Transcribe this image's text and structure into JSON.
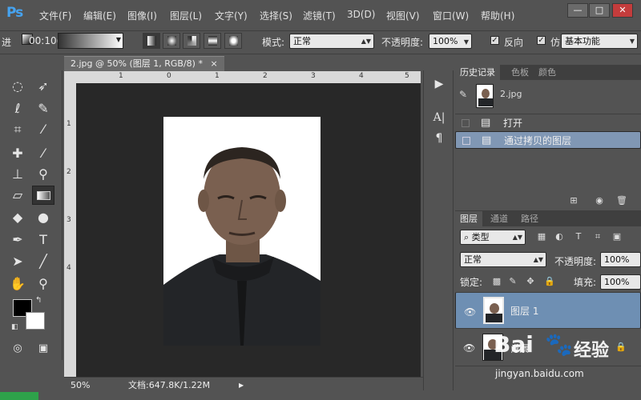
{
  "app": {
    "logo": "Ps"
  },
  "menu": [
    "文件(F)",
    "编辑(E)",
    "图像(I)",
    "图层(L)",
    "文字(Y)",
    "选择(S)",
    "滤镜(T)",
    "3D(D)",
    "视图(V)",
    "窗口(W)",
    "帮助(H)"
  ],
  "window_controls": {
    "minimize": "—",
    "maximize": "□",
    "close": "✕"
  },
  "options": {
    "left_label": "进",
    "progress_text": "00:10(8%)",
    "mode_label": "模式:",
    "mode_value": "正常",
    "opacity_label": "不透明度:",
    "opacity_value": "100%",
    "reverse_label": "反向",
    "dither_label": "仿",
    "workspace_value": "基本功能"
  },
  "document": {
    "tab_title": "2.jpg @ 50% (图层 1, RGB/8) *",
    "tab_close": "×",
    "zoom": "50%",
    "doc_info": "文档:647.8K/1.22M",
    "ruler_top": [
      "1",
      "0",
      "1",
      "2",
      "3",
      "4",
      "5"
    ],
    "ruler_left": [
      "1",
      "2",
      "3",
      "4"
    ]
  },
  "history_panel": {
    "tabs": [
      "历史记录",
      "色板",
      "颜色"
    ],
    "snapshot_name": "2.jpg",
    "items": [
      "打开",
      "通过拷贝的图层"
    ]
  },
  "layers_panel": {
    "tabs": [
      "图层",
      "通道",
      "路径"
    ],
    "filter_label": "类型",
    "blend_mode": "正常",
    "opacity_label": "不透明度:",
    "opacity_value": "100%",
    "lock_label": "锁定:",
    "fill_label": "填充:",
    "fill_value": "100%",
    "layers": [
      {
        "name": "图层 1",
        "selected": true
      },
      {
        "name": "背景",
        "selected": false
      }
    ]
  },
  "watermark": {
    "brand": "Bai",
    "brand_suffix": "经验",
    "url": "jingyan.baidu.com"
  },
  "colors": {
    "accent": "#46a3f0",
    "selection": "#6e8fb3"
  }
}
